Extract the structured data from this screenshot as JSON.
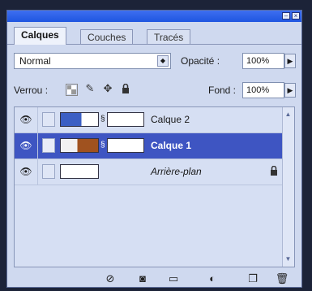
{
  "tabs": [
    {
      "label": "Calques"
    },
    {
      "label": "Couches"
    },
    {
      "label": "Tracés"
    }
  ],
  "blend_mode": "Normal",
  "opacity": {
    "label": "Opacité :",
    "value": "100%"
  },
  "lock": {
    "label": "Verrou :"
  },
  "fill": {
    "label": "Fond :",
    "value": "100%"
  },
  "layers": [
    {
      "name": "Calque 2",
      "selected": false
    },
    {
      "name": "Calque 1",
      "selected": true
    },
    {
      "name": "Arrière-plan",
      "selected": false
    }
  ],
  "icons": {
    "eye": "eye-icon",
    "lock_transparency": "checkerboard-icon",
    "lock_paint": "brush-icon",
    "lock_move": "move-cross-icon",
    "lock_all": "padlock-icon",
    "bottom": [
      "link-layers-icon",
      "layer-style-icon",
      "layer-mask-icon",
      "new-group-icon",
      "adjustment-layer-icon",
      "new-layer-icon",
      "trash-icon"
    ]
  },
  "colors": {
    "panel_bg": "#cfd9ef",
    "selected_row": "#3e55c2",
    "title_bar": "#2a5ee8"
  }
}
